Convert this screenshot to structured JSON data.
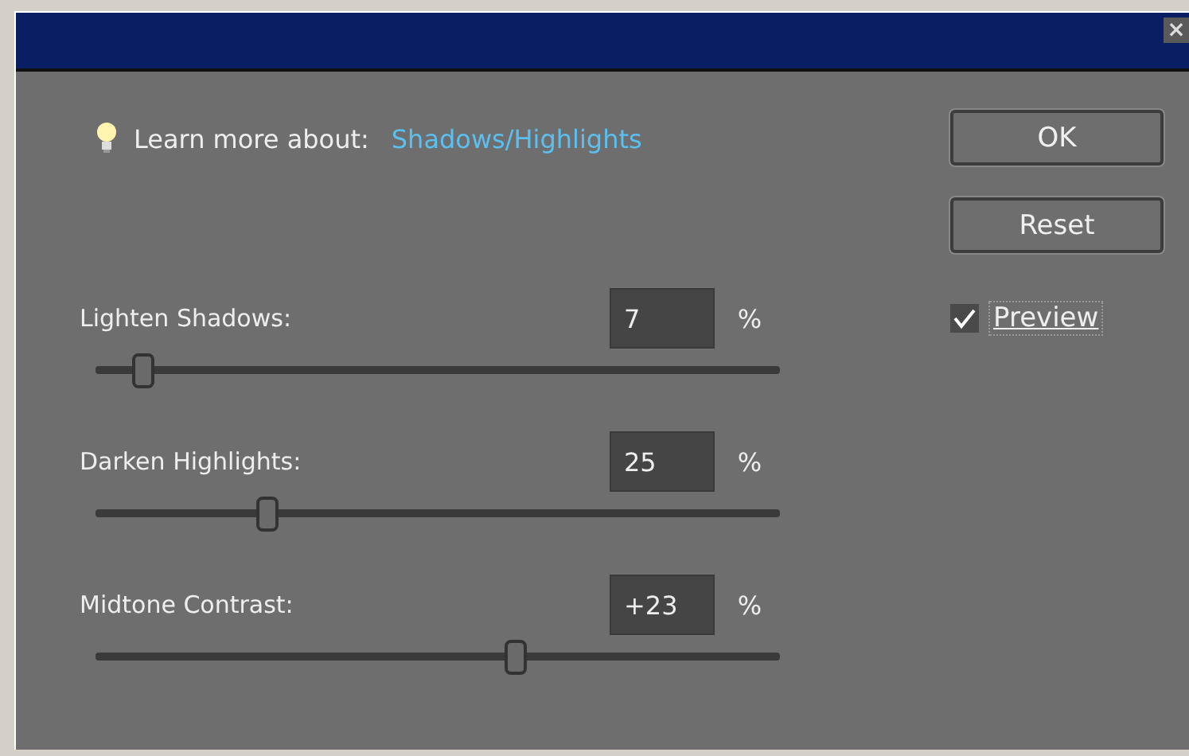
{
  "window": {
    "close": "×"
  },
  "help": {
    "label": "Learn more about:",
    "link": "Shadows/Highlights"
  },
  "sliders": [
    {
      "label": "Lighten Shadows:",
      "value": "7",
      "unit": "%",
      "level": 0.07
    },
    {
      "label": "Darken Highlights:",
      "value": "25",
      "unit": "%",
      "level": 0.25
    },
    {
      "label": "Midtone Contrast:",
      "value": "+23",
      "unit": "%",
      "level": 0.615
    }
  ],
  "buttons": [
    "OK",
    "Reset"
  ],
  "preview": {
    "label": "Preview",
    "checked": true
  }
}
